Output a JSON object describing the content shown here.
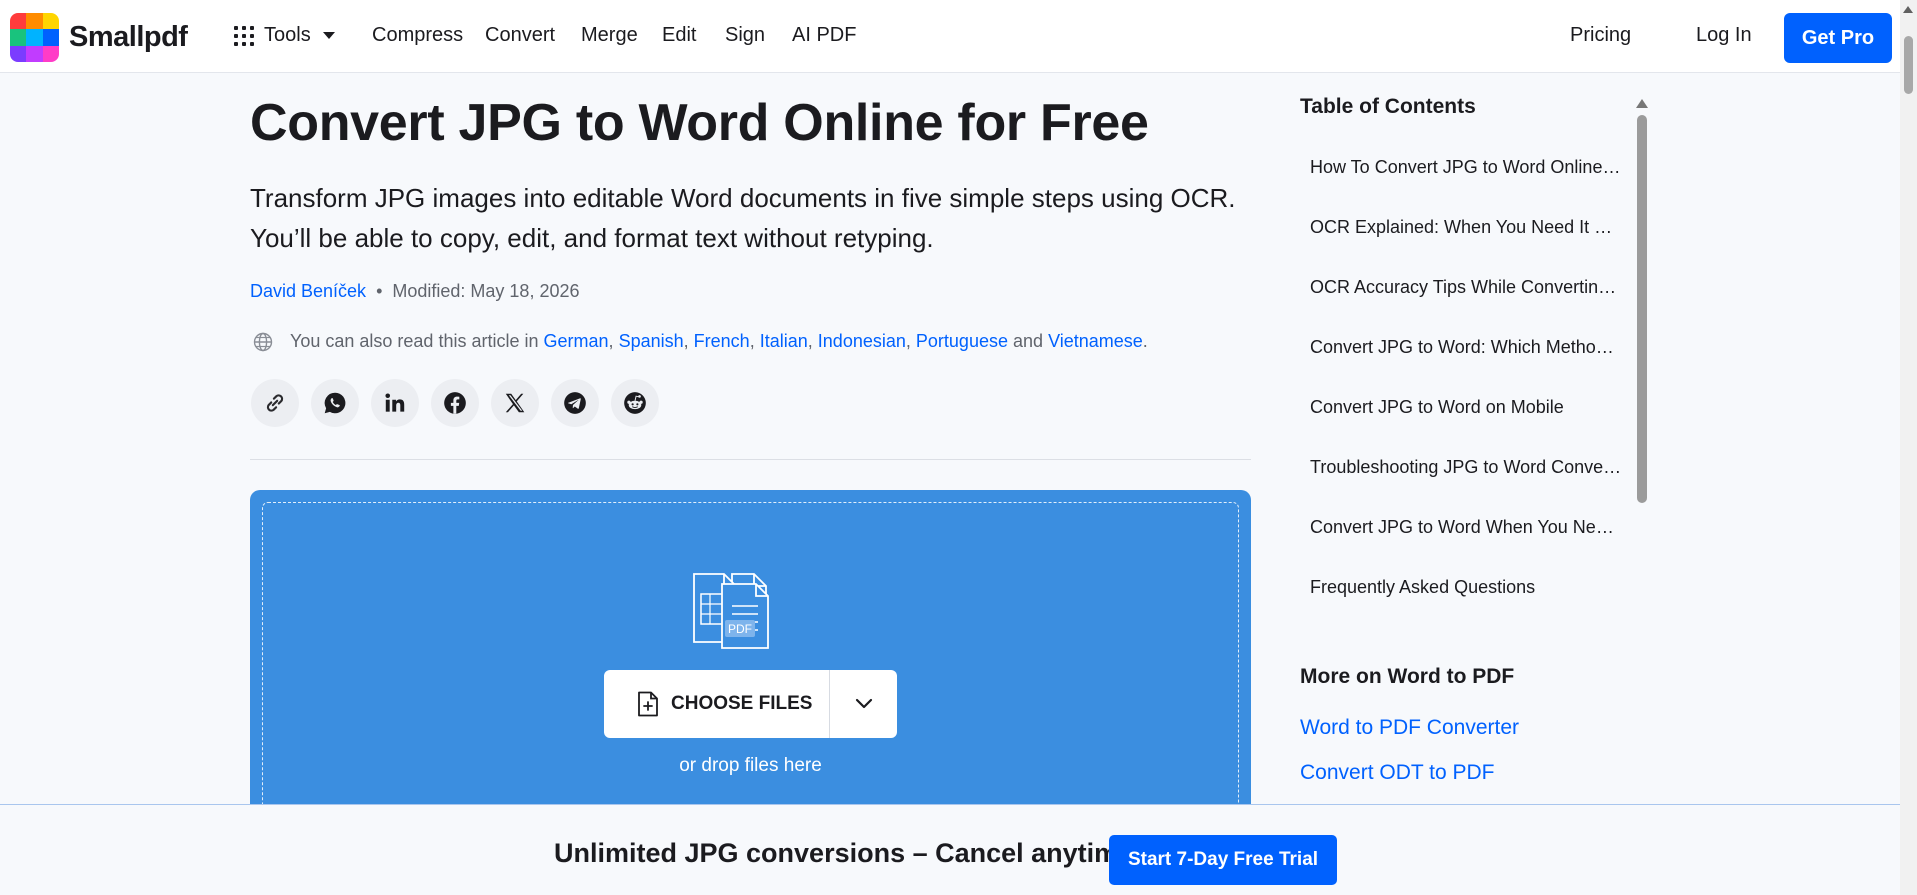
{
  "header": {
    "logo_text": "Smallpdf",
    "logo_colors": [
      "#ff3c3c",
      "#ff8c00",
      "#ffd500",
      "#19c37d",
      "#00b3ff",
      "#0061fe",
      "#7b3cff",
      "#c13cff",
      "#ff3cc7"
    ],
    "tools_label": "Tools",
    "nav": [
      "Compress",
      "Convert",
      "Merge",
      "Edit",
      "Sign",
      "AI PDF"
    ],
    "pricing_label": "Pricing",
    "login_label": "Log In",
    "getpro_label": "Get Pro"
  },
  "article": {
    "title": "Convert JPG to Word Online for Free",
    "lead": "Transform JPG images into editable Word documents in five simple steps using OCR. You’ll be able to copy, edit, and format text without retyping.",
    "author": "David Beníček",
    "bullet": "•",
    "modified": "Modified: May 18, 2026",
    "langs_prefix": "You can also read this article in",
    "languages": [
      "German",
      "Spanish",
      "French",
      "Italian",
      "Indonesian",
      "Portuguese"
    ],
    "langs_and": "and",
    "last_language": "Vietnamese",
    "comma": ",",
    "period": ".",
    "share_icons": [
      "link-icon",
      "whatsapp-icon",
      "linkedin-icon",
      "facebook-icon",
      "x-icon",
      "telegram-icon",
      "reddit-icon"
    ]
  },
  "upload": {
    "pdf_label": "PDF",
    "choose_label": "CHOOSE FILES",
    "drop_text": "or drop files here",
    "background": "#3b8ee0"
  },
  "sidebar": {
    "toc_title": "Table of Contents",
    "toc_items": [
      "How To Convert JPG to Word Online Free",
      "OCR Explained: When You Need It and Why",
      "OCR Accuracy Tips While Converting JPG",
      "Convert JPG to Word: Which Method Is Best",
      "Convert JPG to Word on Mobile",
      "Troubleshooting JPG to Word Conversion",
      "Convert JPG to Word When You Need It",
      "Frequently Asked Questions"
    ],
    "more_title": "More on Word to PDF",
    "more_links": [
      "Word to PDF Converter",
      "Convert ODT to PDF"
    ]
  },
  "banner": {
    "text": "Unlimited JPG conversions – Cancel anytime",
    "cta": "Start 7-Day Free Trial"
  },
  "colors": {
    "accent": "#0061fe",
    "link": "#0061fe"
  }
}
